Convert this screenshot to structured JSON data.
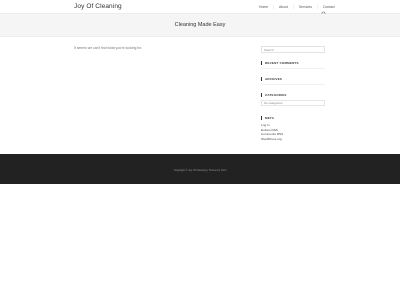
{
  "site": {
    "title": "Joy Of Cleaning"
  },
  "nav": {
    "items": [
      "Home",
      "About",
      "Services",
      "Contact"
    ]
  },
  "page": {
    "title": "Cleaning Made Easy"
  },
  "content": {
    "notice": "It seems we can't find what you're looking for."
  },
  "sidebar": {
    "search_placeholder": "Search",
    "recent_comments_title": "Recent Comments",
    "archives_title": "Archives",
    "categories_title": "Categories",
    "categories_selected": "No categories",
    "meta_title": "Meta",
    "meta_items": [
      "Log in",
      "Entries RSS",
      "Comments RSS",
      "WordPress.org"
    ]
  },
  "footer": {
    "copyright": "Copyright © Joy Of Cleaning | Theme by Ocin"
  }
}
